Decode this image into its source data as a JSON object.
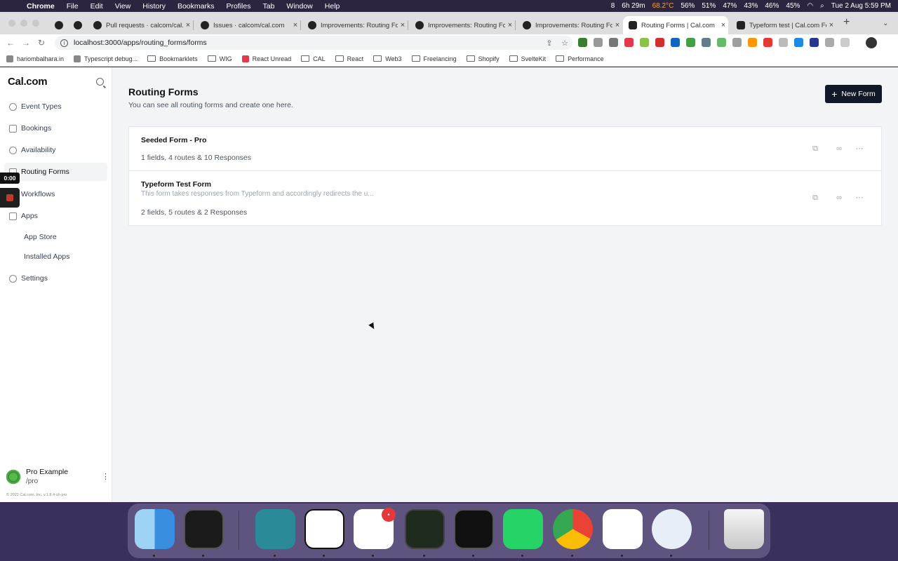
{
  "menubar": {
    "app": "Chrome",
    "items": [
      "File",
      "Edit",
      "View",
      "History",
      "Bookmarks",
      "Profiles",
      "Tab",
      "Window",
      "Help"
    ],
    "status": {
      "badge_count": "8",
      "battery_time": "6h 29m",
      "temp": "68.2°C",
      "stats": [
        "56%",
        "51%",
        "47%",
        "43%",
        "46%",
        "45%"
      ],
      "datetime": "Tue 2 Aug  5:59 PM"
    }
  },
  "browser": {
    "tabs": [
      {
        "title": "",
        "active": false
      },
      {
        "title": "",
        "active": false
      },
      {
        "title": "Pull requests · calcom/cal.",
        "active": false
      },
      {
        "title": "Issues · calcom/cal.com",
        "active": false
      },
      {
        "title": "Improvements: Routing Fo",
        "active": false
      },
      {
        "title": "Improvements: Routing Fo",
        "active": false
      },
      {
        "title": "Improvements: Routing Fo",
        "active": false
      },
      {
        "title": "Routing Forms | Cal.com",
        "active": true
      },
      {
        "title": "Typeform test | Cal.com Fo",
        "active": false
      }
    ],
    "url": "localhost:3000/apps/routing_forms/forms",
    "bookmarks": [
      "hariombalhara.in",
      "Typescript debug...",
      "Bookmarklets",
      "WIG",
      "React Unread",
      "CAL",
      "React",
      "Web3",
      "Freelancing",
      "Shopify",
      "SvelteKit",
      "Performance"
    ]
  },
  "sidebar": {
    "logo": "Cal.com",
    "nav": [
      {
        "label": "Event Types",
        "icon": "link-icon"
      },
      {
        "label": "Bookings",
        "icon": "calendar-icon"
      },
      {
        "label": "Availability",
        "icon": "clock-icon"
      },
      {
        "label": "Routing Forms",
        "icon": "routing-icon",
        "active": true
      },
      {
        "label": "Workflows",
        "icon": "workflow-icon"
      },
      {
        "label": "Apps",
        "icon": "grid-icon"
      }
    ],
    "apps_sub": [
      "App Store",
      "Installed Apps"
    ],
    "settings": "Settings",
    "recording_timer": "0:00",
    "user": {
      "name": "Pro Example",
      "handle": "/pro"
    },
    "copyright": "© 2022 Cal.com, Inc. v.1.8.4-sh-pro"
  },
  "main": {
    "title": "Routing Forms",
    "subtitle": "You can see all routing forms and create one here.",
    "new_form": "New Form",
    "forms": [
      {
        "name": "Seeded Form - Pro",
        "description": "",
        "meta": "1 fields, 4 routes & 10 Responses"
      },
      {
        "name": "Typeform Test Form",
        "description": "This form takes responses from Typeform and accordingly redirects the u...",
        "meta": "2 fields, 5 routes & 2 Responses"
      }
    ]
  },
  "dock": [
    "Finder",
    "iTerm",
    "Paw",
    "Notion",
    "Slack",
    "Activity Monitor",
    "Terminal",
    "WhatsApp",
    "Chrome",
    "VS Code",
    "1Password",
    "Trash"
  ],
  "dock_badge": "•"
}
